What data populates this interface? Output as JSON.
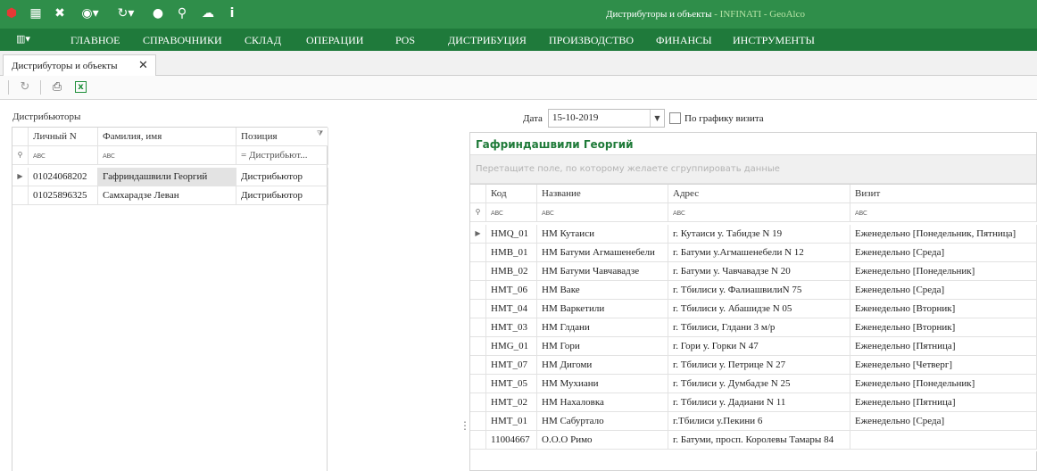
{
  "window": {
    "title": "Дистрибуторы и объекты",
    "app": " - INFINATI - GeoAlco"
  },
  "quick_toolbar": [
    "app-logo-icon",
    "calendar-icon",
    "tools-icon",
    "palette-icon",
    "refresh-icon",
    "user-icon",
    "search-icon",
    "cloud-icon",
    "info-icon"
  ],
  "menu": {
    "items": [
      "ГЛАВНОЕ",
      "СПРАВОЧНИКИ",
      "СКЛАД",
      "ОПЕРАЦИИ",
      "POS",
      "ДИСТРИБУЦИЯ",
      "ПРОИЗВОДСТВО",
      "ФИНАНСЫ",
      "ИНСТРУМЕНТЫ"
    ]
  },
  "doc_tab": {
    "label": "Дистрибуторы и объекты",
    "close": "✕"
  },
  "toolbar": [
    "refresh-icon",
    "print-icon",
    "excel-icon"
  ],
  "left": {
    "caption": "Дистрибьюторы",
    "columns": [
      "Личный N",
      "Фамилия, имя",
      "Позиция"
    ],
    "filter_position": "= Дистрибьют...",
    "rows": [
      {
        "id": "01024068202",
        "name": "Гафриндашвили Георгий",
        "position": "Дистрибьютор"
      },
      {
        "id": "01025896325",
        "name": "Самхарадзе Леван",
        "position": "Дистрибьютор"
      }
    ]
  },
  "date_filter": {
    "label": "Дата",
    "value": "15-10-2019",
    "visit_schedule_label": "По графику визита"
  },
  "right": {
    "title": "Гафриндашвили Георгий",
    "group_hint": "Перетащите поле, по которому желаете сгруппировать данные",
    "columns": [
      "Код",
      "Название",
      "Адрес",
      "Визит"
    ],
    "rows": [
      {
        "code": "HMQ_01",
        "name": "НМ  Кутаиси",
        "address": "г. Кутаиси у. Табидзе  N 19",
        "visit": "Еженедельно [Понедельник, Пятница]"
      },
      {
        "code": "HMB_01",
        "name": "НМ Батуми Агмашенебели",
        "address": " г. Батуми у.Агмашенебели N 12",
        "visit": "Еженедельно [Среда]"
      },
      {
        "code": "HMB_02",
        "name": "НМ Батуми Чавчавадзе",
        "address": "г. Батуми у. Чавчавадзе N 20",
        "visit": "Еженедельно [Понедельник]"
      },
      {
        "code": "HMT_06",
        "name": "НМ Ваке",
        "address": "г. Тбилиси у. ФалиашвилиN 75",
        "visit": "Еженедельно [Среда]"
      },
      {
        "code": "HMT_04",
        "name": "НМ Варкетили",
        "address": "г. Тбилиси у. Абашидзе N 05",
        "visit": "Еженедельно [Вторник]"
      },
      {
        "code": "HMT_03",
        "name": "НМ Глдани",
        "address": "г. Тбилиси, Глдани 3 м/р",
        "visit": "Еженедельно [Вторник]"
      },
      {
        "code": "HMG_01",
        "name": "НМ Гори",
        "address": "г. Гори у. Горки  N 47",
        "visit": "Еженедельно [Пятница]"
      },
      {
        "code": "HMT_07",
        "name": "НМ Дигоми",
        "address": "г. Тбилиси у. Петрице  N 27",
        "visit": "Еженедельно [Четверг]"
      },
      {
        "code": "HMT_05",
        "name": "НМ Мухиани",
        "address": "г. Тбилиси у. Думбадзе N 25",
        "visit": "Еженедельно [Понедельник]"
      },
      {
        "code": "HMT_02",
        "name": "НМ Нахаловка",
        "address": "г. Тбилиси у. Дадиани N 11",
        "visit": "Еженедельно [Пятница]"
      },
      {
        "code": "HMT_01",
        "name": "НМ Сабуртало",
        "address": "г.Тбилиси у.Пекини 6",
        "visit": "Еженедельно [Среда]"
      },
      {
        "code": "11004667",
        "name": "О.О.О Римо",
        "address": "г. Батуми, просп. Королевы Тамары 84",
        "visit": ""
      }
    ]
  }
}
